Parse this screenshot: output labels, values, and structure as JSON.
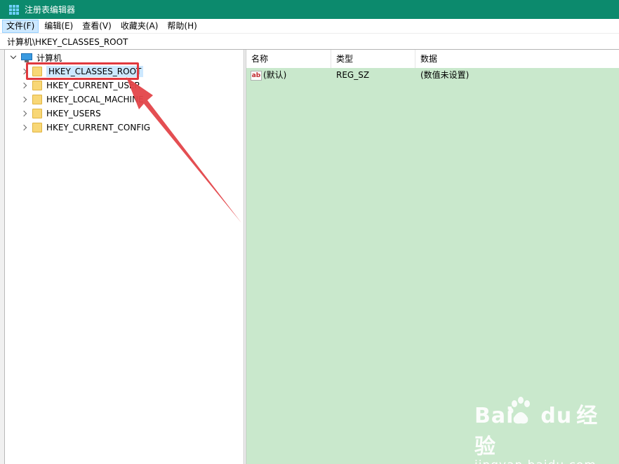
{
  "window": {
    "title": "注册表编辑器"
  },
  "menu": [
    "文件(F)",
    "编辑(E)",
    "查看(V)",
    "收藏夹(A)",
    "帮助(H)"
  ],
  "address": "计算机\\HKEY_CLASSES_ROOT",
  "tree": {
    "root": "计算机",
    "children": [
      "HKEY_CLASSES_ROOT",
      "HKEY_CURRENT_USER",
      "HKEY_LOCAL_MACHINE",
      "HKEY_USERS",
      "HKEY_CURRENT_CONFIG"
    ],
    "selected": "HKEY_CLASSES_ROOT"
  },
  "list": {
    "headers": [
      "名称",
      "类型",
      "数据"
    ],
    "rows": [
      {
        "name": "(默认)",
        "type": "REG_SZ",
        "data": "(数值未设置)",
        "icon": "ab-string-icon"
      }
    ]
  },
  "annotation": {
    "color": "#e0393e"
  },
  "watermark": {
    "brand": "Bai",
    "brand2": "du",
    "product": "经验",
    "site": "jingyan.baidu.com"
  },
  "colors": {
    "titlebar": "#0c8a6d",
    "list_bg": "#c9e8cc",
    "selection": "#cce8ff"
  }
}
